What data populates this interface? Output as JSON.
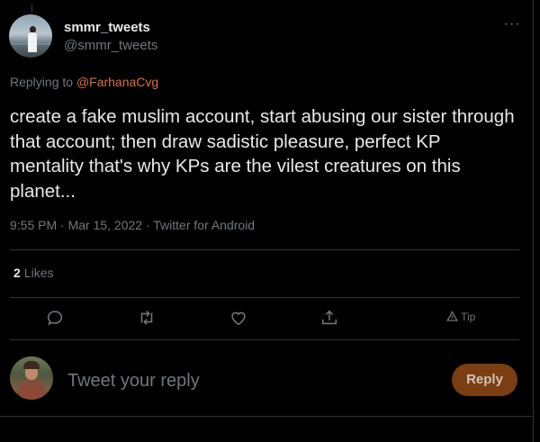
{
  "author": {
    "display_name": "smmr_tweets",
    "handle": "@smmr_tweets",
    "more_icon": "ellipsis-icon"
  },
  "reply_context": {
    "prefix": "Replying to",
    "mention": "@FarhanaCvg"
  },
  "tweet": {
    "text": "create a fake muslim account, start abusing our sister through that account; then draw sadistic pleasure, perfect KP mentality that's why KPs are the vilest creatures on this planet...",
    "meta": "9:55 PM · Mar 15, 2022 · Twitter for Android"
  },
  "stats": {
    "likes_count": "2",
    "likes_label": "Likes"
  },
  "actions": {
    "icons": [
      "reply-icon",
      "retweet-icon",
      "like-icon",
      "share-icon",
      "tip-icon"
    ],
    "tip_label": "Tip"
  },
  "reply_composer": {
    "placeholder": "Tweet your reply",
    "button_label": "Reply"
  },
  "colors": {
    "background": "#000000",
    "text": "#e7e9ea",
    "muted": "#71767b",
    "mention": "#d9713c",
    "reply_button": "#7a3e12",
    "divider": "#2f3336"
  }
}
